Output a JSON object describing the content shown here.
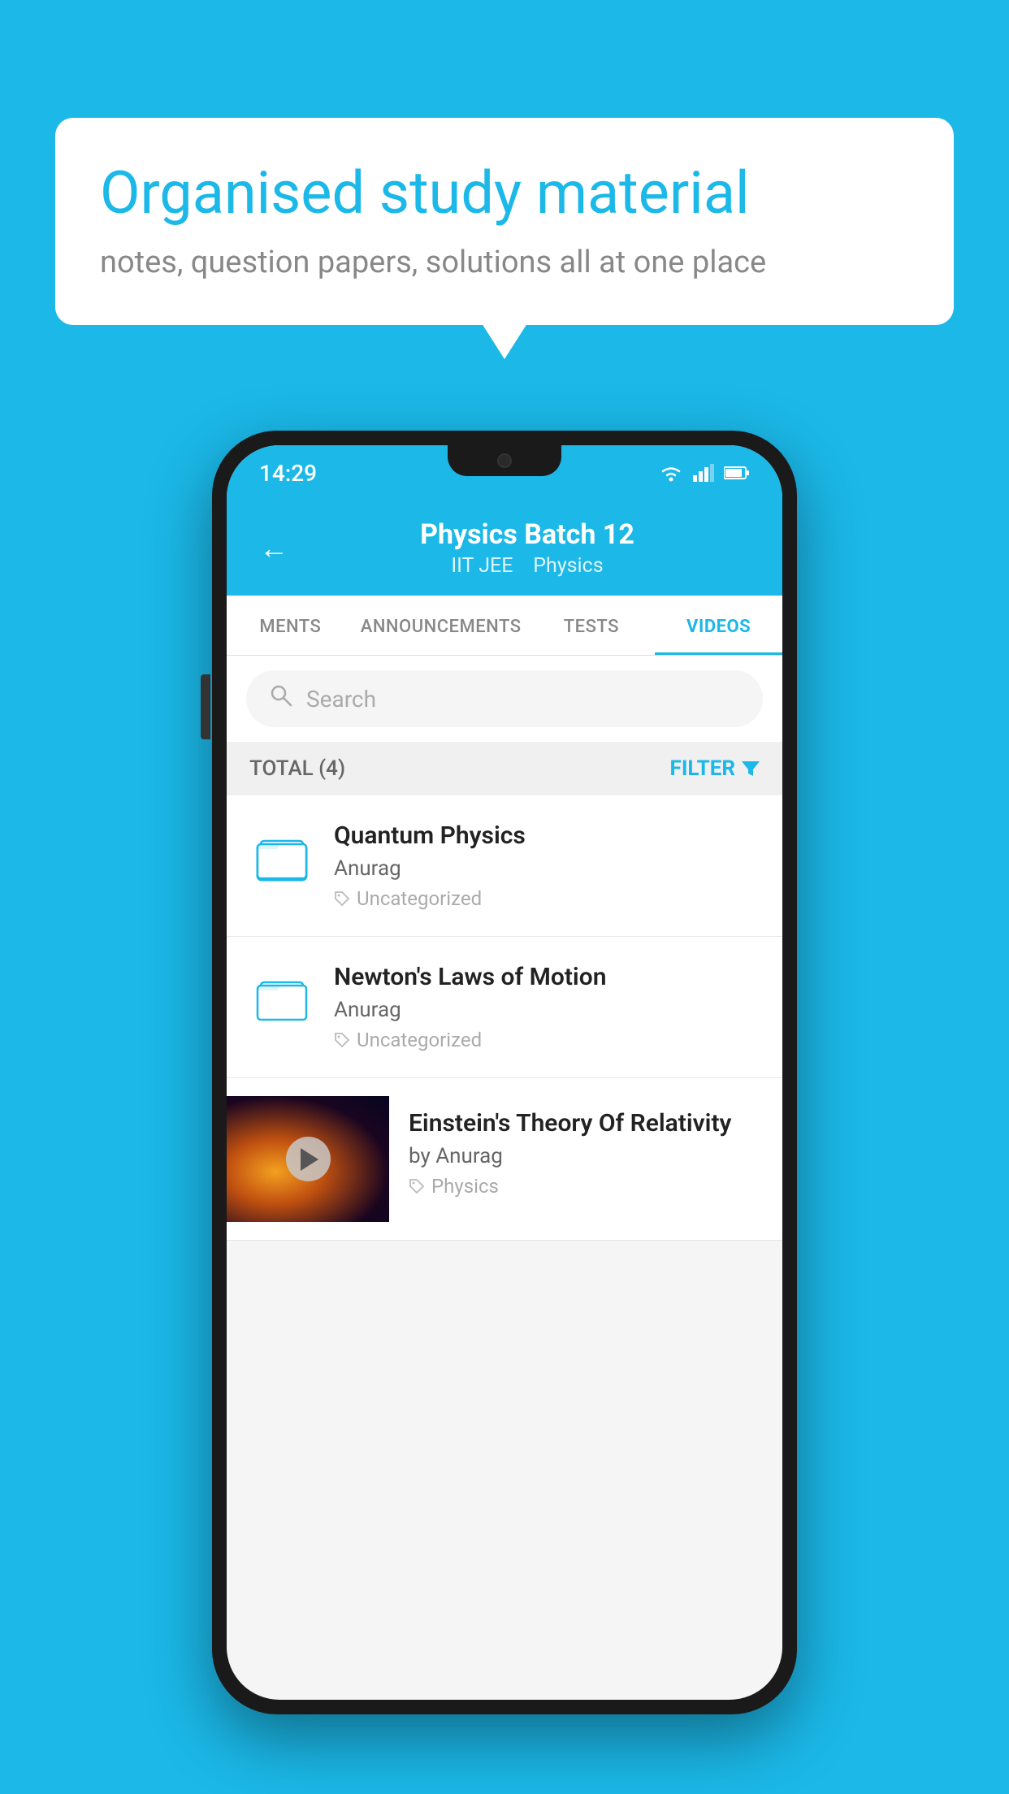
{
  "background_color": "#1BB8E8",
  "bubble": {
    "title": "Organised study material",
    "subtitle": "notes, question papers, solutions all at one place"
  },
  "phone": {
    "status_bar": {
      "time": "14:29",
      "icons": [
        "wifi",
        "signal",
        "battery"
      ]
    },
    "header": {
      "back_label": "←",
      "title": "Physics Batch 12",
      "subtitle_parts": [
        "IIT JEE",
        "Physics"
      ]
    },
    "tabs": [
      {
        "label": "MENTS",
        "active": false
      },
      {
        "label": "ANNOUNCEMENTS",
        "active": false
      },
      {
        "label": "TESTS",
        "active": false
      },
      {
        "label": "VIDEOS",
        "active": true
      }
    ],
    "search": {
      "placeholder": "Search"
    },
    "filter_bar": {
      "total_label": "TOTAL (4)",
      "filter_label": "FILTER"
    },
    "videos": [
      {
        "id": 1,
        "title": "Quantum Physics",
        "author": "Anurag",
        "tag": "Uncategorized",
        "has_thumbnail": false
      },
      {
        "id": 2,
        "title": "Newton's Laws of Motion",
        "author": "Anurag",
        "tag": "Uncategorized",
        "has_thumbnail": false
      },
      {
        "id": 3,
        "title": "Einstein's Theory Of Relativity",
        "author": "by Anurag",
        "tag": "Physics",
        "has_thumbnail": true
      }
    ]
  }
}
